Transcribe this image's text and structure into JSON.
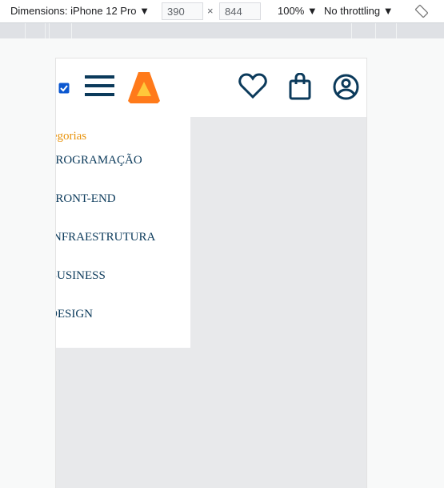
{
  "devtools": {
    "dimensions_label": "Dimensions: iPhone 12 Pro",
    "width": "390",
    "height": "844",
    "times": "×",
    "zoom": "100%",
    "throttling": "No throttling"
  },
  "colors": {
    "primary": "#0b3a5b",
    "accent": "#e8930c",
    "logo_orange": "#ff7a1a",
    "logo_yellow": "#ffc83a"
  },
  "menu": {
    "title": "Categorias",
    "items": [
      "PROGRAMAÇÃO",
      "FRONT-END",
      "INFRAESTRUTURA",
      "BUSINESS",
      "DESIGN"
    ]
  }
}
